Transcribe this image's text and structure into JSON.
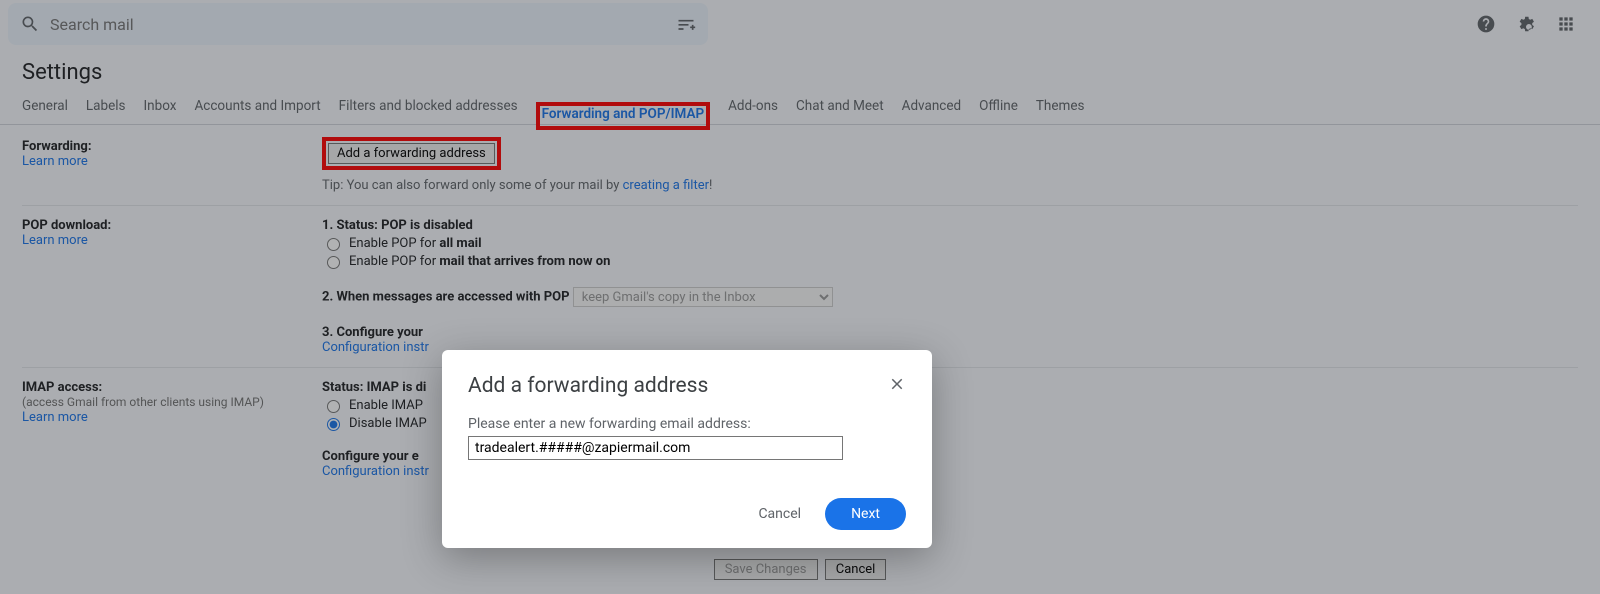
{
  "search": {
    "placeholder": "Search mail"
  },
  "page_title": "Settings",
  "tabs": {
    "general": "General",
    "labels": "Labels",
    "inbox": "Inbox",
    "accounts": "Accounts and Import",
    "filters": "Filters and blocked addresses",
    "fwd": "Forwarding and POP/IMAP",
    "addons": "Add-ons",
    "chat": "Chat and Meet",
    "advanced": "Advanced",
    "offline": "Offline",
    "themes": "Themes"
  },
  "forwarding": {
    "label": "Forwarding:",
    "learn_more": "Learn more",
    "add_btn": "Add a forwarding address",
    "tip_prefix": "Tip: You can also forward only some of your mail by ",
    "tip_link": "creating a filter",
    "tip_suffix": "!"
  },
  "pop": {
    "title": "POP download:",
    "learn_more": "Learn more",
    "status_prefix": "1. Status: ",
    "status_value": "POP is disabled",
    "opt1_prefix": "Enable POP for ",
    "opt1_bold": "all mail",
    "opt2_prefix": "Enable POP for ",
    "opt2_bold": "mail that arrives from now on",
    "when_prefix": "2. When messages are accessed with POP",
    "when_select": "keep Gmail's copy in the Inbox",
    "configure_label": "3. Configure your",
    "configure_link": "Configuration instr"
  },
  "imap": {
    "title": "IMAP access:",
    "subtitle": "(access Gmail from other clients using IMAP)",
    "learn_more": "Learn more",
    "status_prefix": "Status: ",
    "status_value": "IMAP is di",
    "enable": "Enable IMAP",
    "disable": "Disable IMAP",
    "configure_label": "Configure your e",
    "configure_link": "Configuration instr"
  },
  "footer": {
    "save": "Save Changes",
    "cancel": "Cancel"
  },
  "dialog": {
    "title": "Add a forwarding address",
    "message": "Please enter a new forwarding email address:",
    "value": "tradealert.#####@zapiermail.com",
    "cancel": "Cancel",
    "next": "Next"
  }
}
